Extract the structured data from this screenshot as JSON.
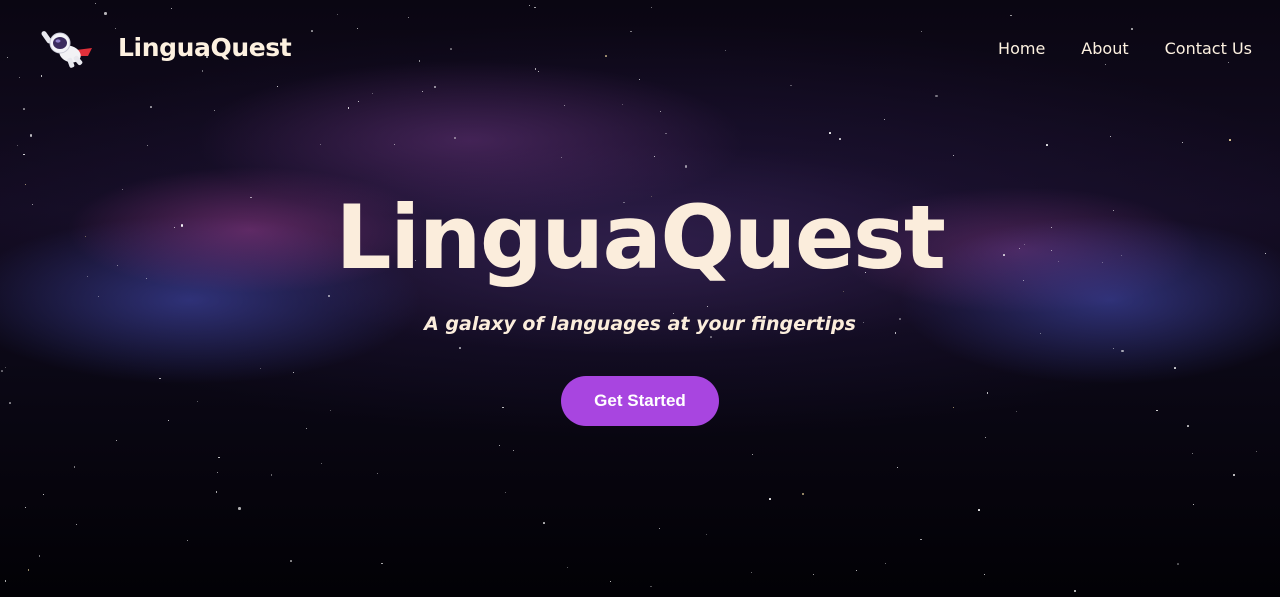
{
  "header": {
    "logo_icon": "astronaut-icon",
    "brand": "LinguaQuest",
    "nav": [
      {
        "label": "Home"
      },
      {
        "label": "About"
      },
      {
        "label": "Contact Us"
      }
    ]
  },
  "hero": {
    "title": "LinguaQuest",
    "subtitle": "A galaxy of languages at your fingertips",
    "cta_label": "Get Started"
  },
  "colors": {
    "text": "#fbeddc",
    "accent": "#a845e0",
    "background": "#0b0816"
  }
}
